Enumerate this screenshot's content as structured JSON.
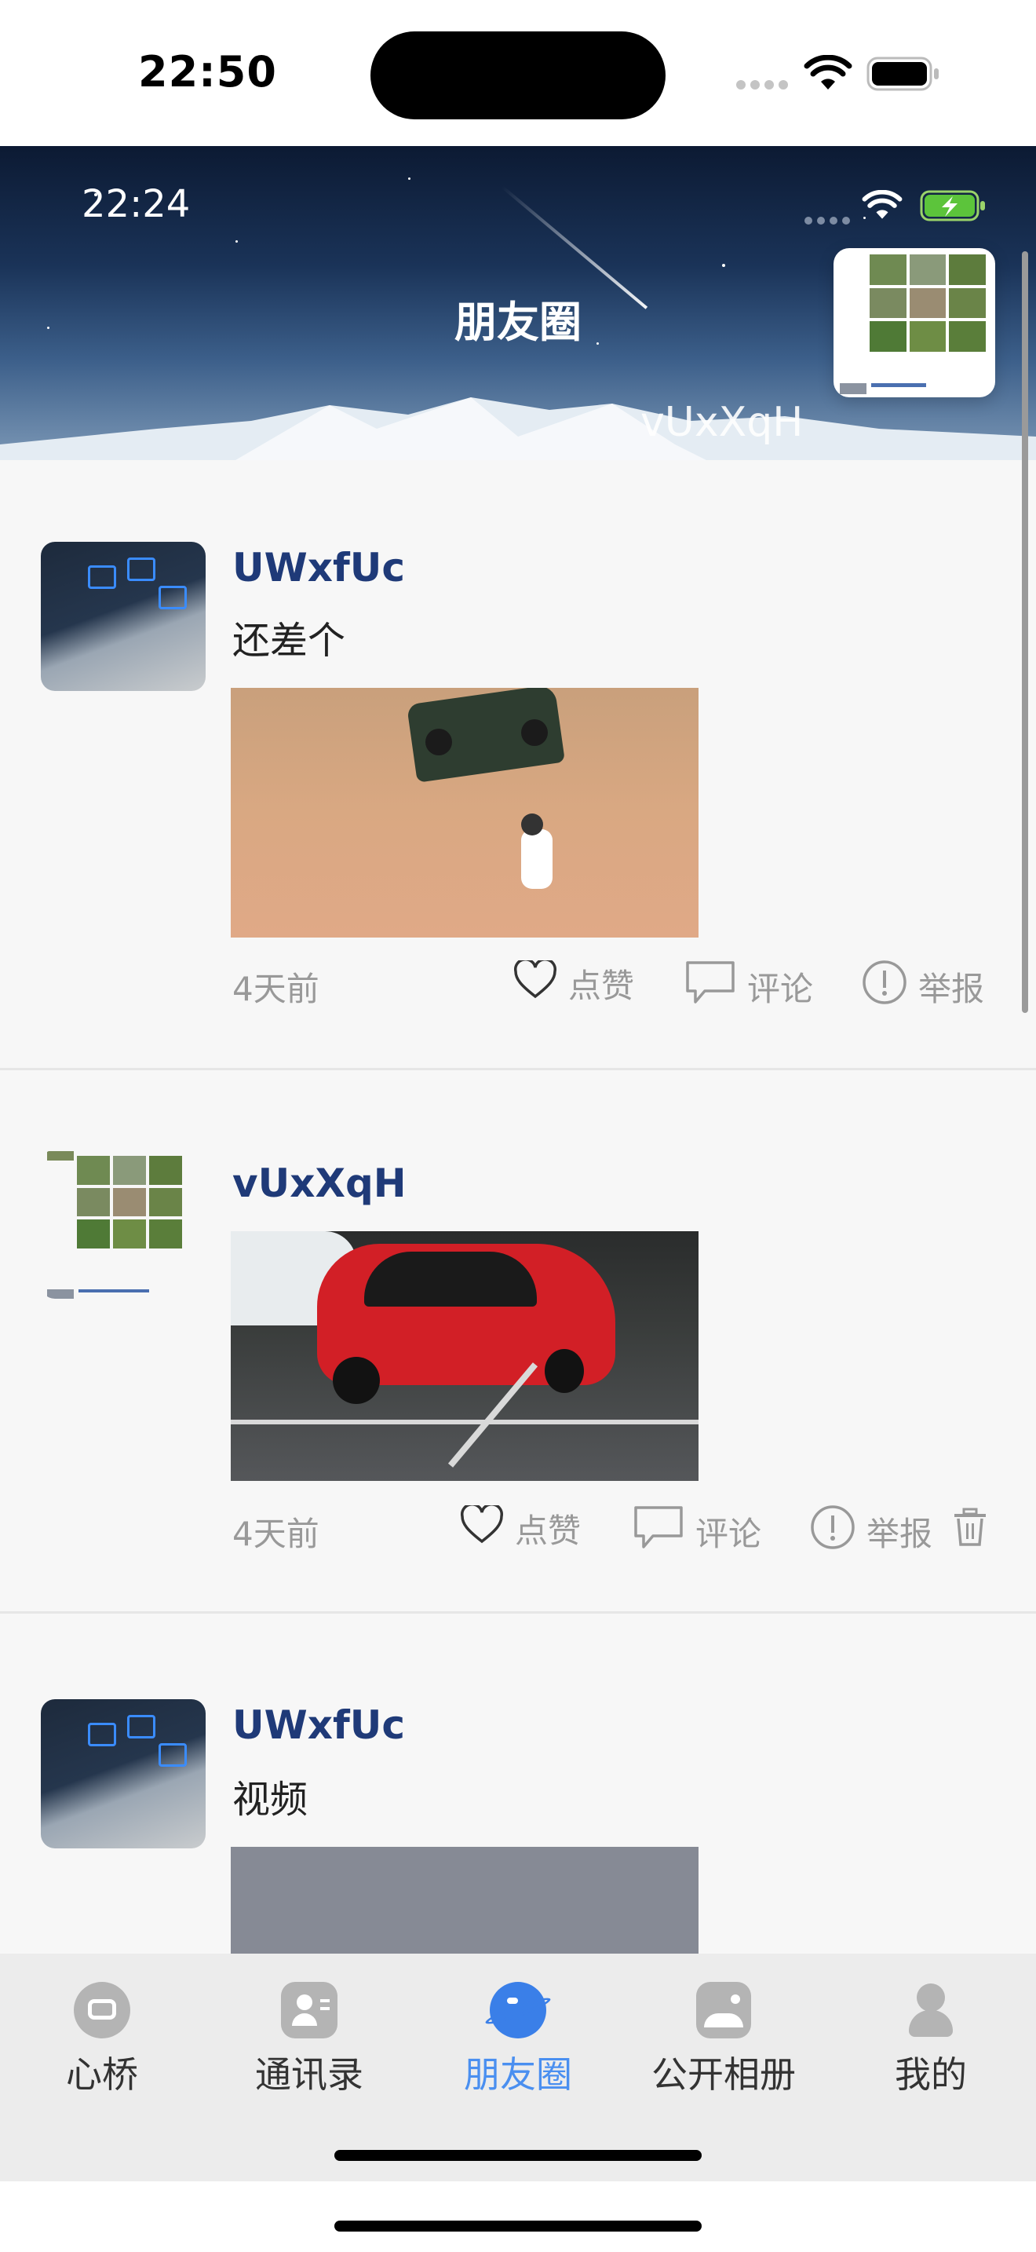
{
  "device": {
    "time": "22:50"
  },
  "header": {
    "status_time": "22:24",
    "title": "朋友圈",
    "username": "vUxXqH"
  },
  "posts": [
    {
      "username": "UWxfUc",
      "text": "还差个",
      "image": "green-suv-in-mud-photo",
      "time": "4天前",
      "like": "点赞",
      "comment": "评论",
      "report": "举报",
      "deletable": false
    },
    {
      "username": "vUxXqH",
      "text": "",
      "image": "red-hatchback-parking-photo",
      "time": "4天前",
      "like": "点赞",
      "comment": "评论",
      "report": "举报",
      "deletable": true
    },
    {
      "username": "UWxfUc",
      "text": "视频",
      "image": "video-placeholder",
      "time": "",
      "like": "",
      "comment": "",
      "report": "",
      "deletable": false
    }
  ],
  "tabs": [
    {
      "label": "心桥",
      "icon": "chat-bubble-icon",
      "active": false
    },
    {
      "label": "通讯录",
      "icon": "contacts-icon",
      "active": false
    },
    {
      "label": "朋友圈",
      "icon": "planet-icon",
      "active": true
    },
    {
      "label": "公开相册",
      "icon": "photo-album-icon",
      "active": false
    },
    {
      "label": "我的",
      "icon": "profile-icon",
      "active": false
    }
  ],
  "colors": {
    "accent": "#4a8ff0",
    "username": "#1f3a78",
    "muted": "#999999"
  }
}
